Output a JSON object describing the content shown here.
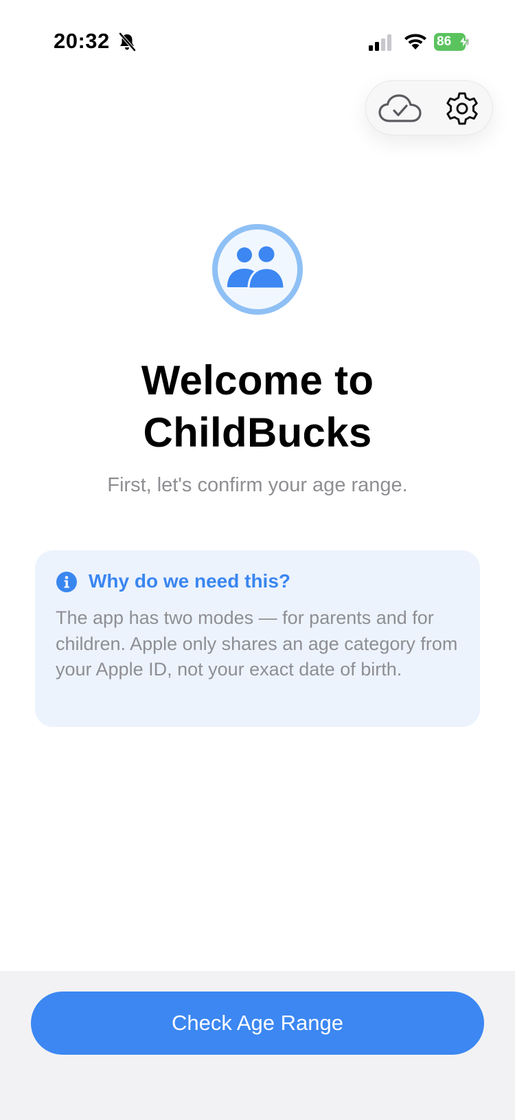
{
  "status_bar": {
    "time": "20:32",
    "battery_level": "86",
    "icons": [
      "bell-slash-icon",
      "cellular-signal-icon",
      "wifi-icon",
      "battery-charging-icon"
    ]
  },
  "toolbar": {
    "icons": [
      "cloud-check-icon",
      "gear-icon"
    ]
  },
  "hero": {
    "icon": "people-icon",
    "title_line1": "Welcome to",
    "title_line2": "ChildBucks",
    "subtitle": "First, let's confirm your age range."
  },
  "info_card": {
    "icon": "info-icon",
    "title": "Why do we need this?",
    "body": "The app has two modes — for parents and for children. Apple only shares an age category from your Apple ID, not your exact date of birth."
  },
  "actions": {
    "primary_label": "Check Age Range"
  },
  "colors": {
    "accent": "#3c87f2",
    "accent_light": "#8ec0f5",
    "card_bg": "#ecf3fd",
    "secondary_text": "#8e8e93",
    "battery": "#5ac35e",
    "bottom_bg": "#f2f2f4"
  }
}
